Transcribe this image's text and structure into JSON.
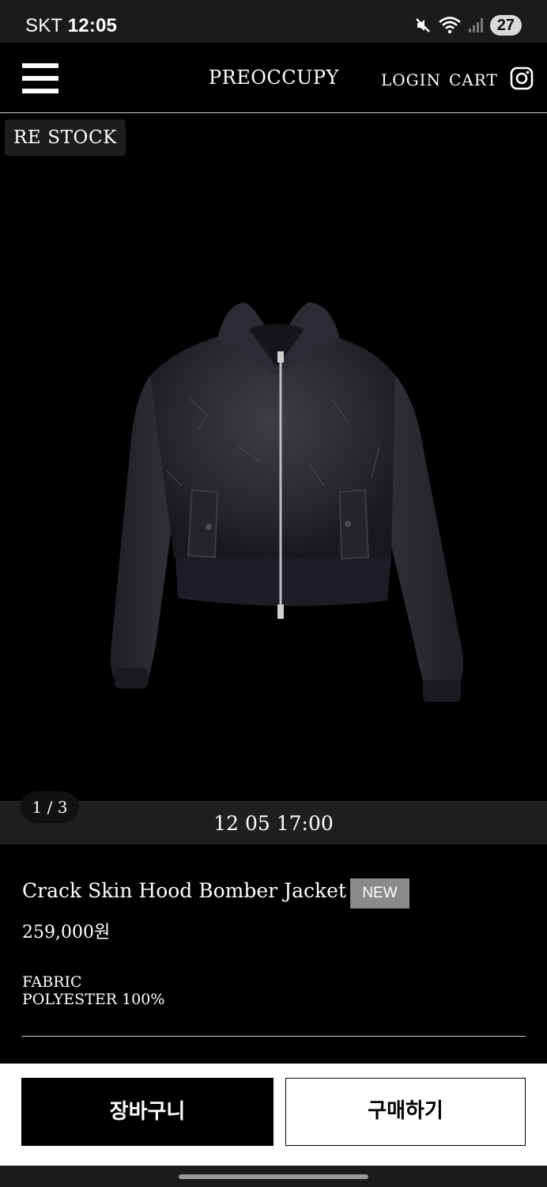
{
  "status_bar": {
    "carrier": "SKT",
    "time": "12:05",
    "battery": "27"
  },
  "header": {
    "brand": "PREOCCUPY",
    "login": "LOGIN",
    "cart": "CART"
  },
  "gallery": {
    "badge": "RE STOCK",
    "counter": "1 / 3",
    "release_datetime": "12 05 17:00"
  },
  "product": {
    "name": "Crack Skin Hood Bomber Jacket",
    "tag": "NEW",
    "price": "259,000원",
    "fabric_label": "FABRIC",
    "fabric_value": "POLYESTER 100%"
  },
  "actions": {
    "add_to_cart": "장바구니",
    "buy_now": "구매하기"
  },
  "colors": {
    "background": "#000000",
    "badge_new": "#8a8a8a",
    "button_primary": "#000000",
    "button_secondary": "#ffffff"
  }
}
